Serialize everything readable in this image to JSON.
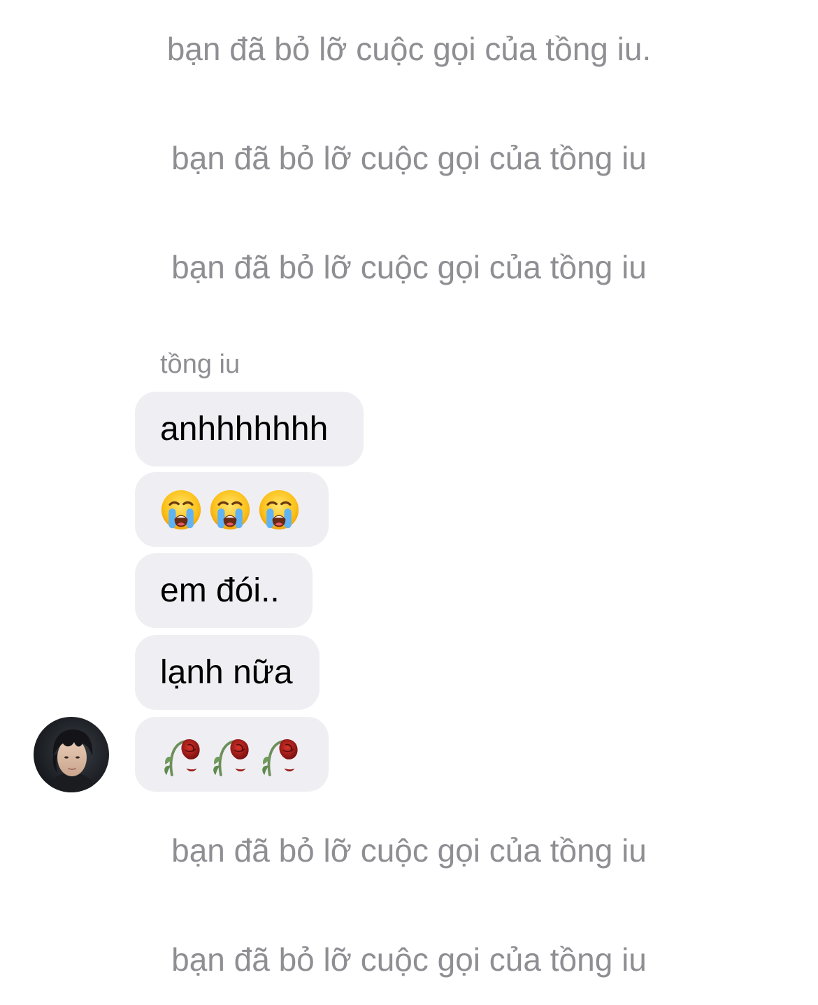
{
  "missed_calls_top": [
    "bạn đã bỏ lỡ cuộc gọi của tồng iu.",
    "bạn đã bỏ lỡ cuộc gọi của tồng iu",
    "bạn đã bỏ lỡ cuộc gọi của tồng iu"
  ],
  "sender_name": "tồng iu",
  "messages": [
    {
      "text": "anhhhhhhh"
    },
    {
      "emoji": [
        "loudly-crying-face",
        "loudly-crying-face",
        "loudly-crying-face"
      ]
    },
    {
      "text": "em đói.."
    },
    {
      "text": "lạnh nữa"
    },
    {
      "emoji": [
        "wilted-flower",
        "wilted-flower",
        "wilted-flower"
      ]
    }
  ],
  "missed_calls_bottom": [
    "bạn đã bỏ lỡ cuộc gọi của tồng iu",
    "bạn đã bỏ lỡ cuộc gọi của tồng iu"
  ],
  "colors": {
    "system_text": "#8e8e93",
    "bubble_bg": "#efeff3",
    "message_text": "#000000"
  }
}
